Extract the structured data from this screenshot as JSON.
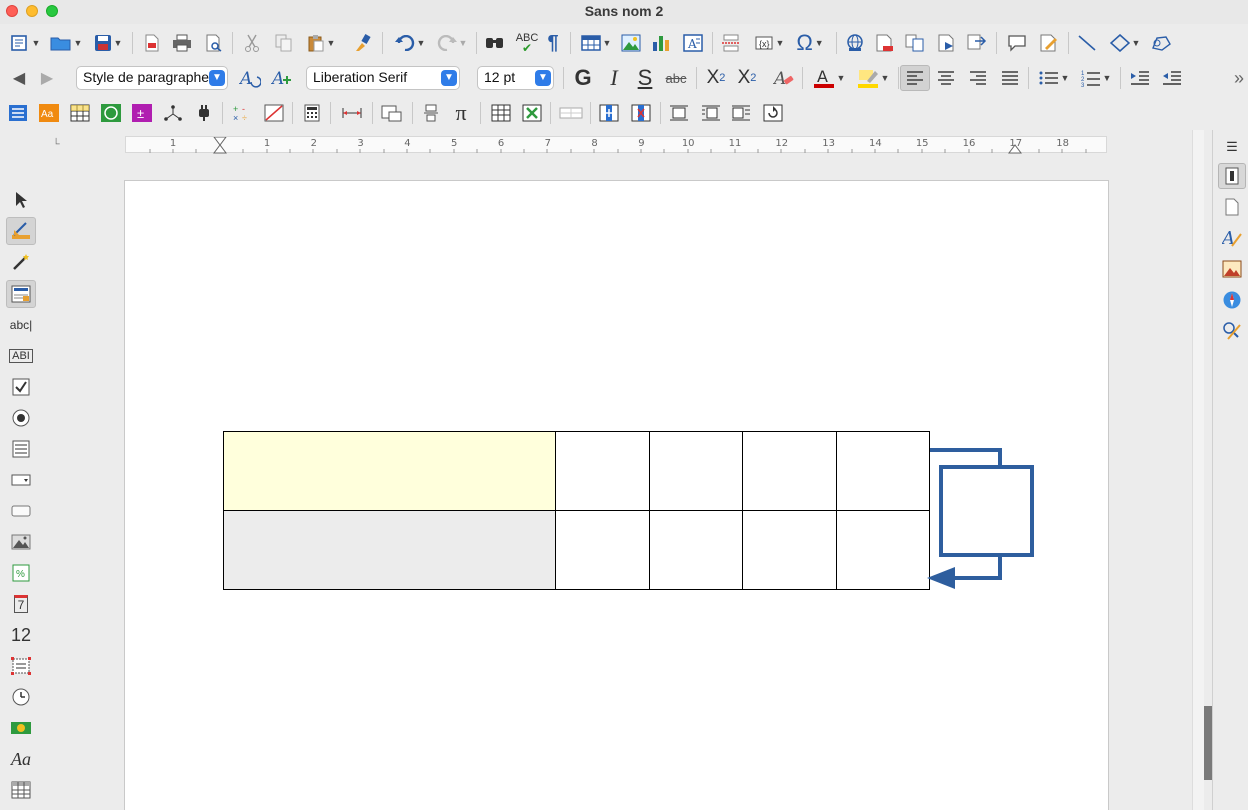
{
  "window": {
    "title": "Sans nom 2"
  },
  "colors": {
    "accent": "#2a5da8",
    "highlight_cell": "#ffffdc",
    "gray_cell": "#ececec",
    "connector": "#2e5e9e"
  },
  "formatting": {
    "paragraph_style": "Style de paragraphe",
    "font_name": "Liberation Serif",
    "font_size": "12 pt",
    "bold_label": "G",
    "italic_label": "I",
    "strike_label": "S",
    "strikethrough_abc": "abc",
    "superscript_label": "X",
    "superscript_sup": "2",
    "subscript_label": "X",
    "subscript_sub": "2"
  },
  "toolbar": {
    "spellcheck_label": "ABC",
    "pilcrow": "¶",
    "omega": "Ω",
    "pi": "π"
  },
  "form_controls": {
    "label_field": "abc|",
    "text_box": "ABI",
    "numeric_field": "12",
    "date_field": "7",
    "font_work": "Aa"
  },
  "ruler": {
    "numbers": [
      "1",
      "1",
      "2",
      "3",
      "4",
      "5",
      "6",
      "7",
      "8",
      "9",
      "10",
      "11",
      "12",
      "13",
      "14",
      "15",
      "16",
      "17",
      "18"
    ]
  },
  "icons": {
    "left_sidebar": [
      "select-icon",
      "design-mode-icon",
      "wizard-icon",
      "form-properties-icon",
      "label-icon",
      "text-box-icon",
      "checkbox-icon",
      "option-button-icon",
      "list-box-icon",
      "combo-box-icon",
      "push-button-icon",
      "image-button-icon",
      "formatted-field-icon",
      "date-field-icon",
      "numeric-field-icon",
      "pattern-field-icon",
      "time-field-icon",
      "currency-field-icon",
      "fontwork-icon",
      "table-control-icon"
    ]
  }
}
